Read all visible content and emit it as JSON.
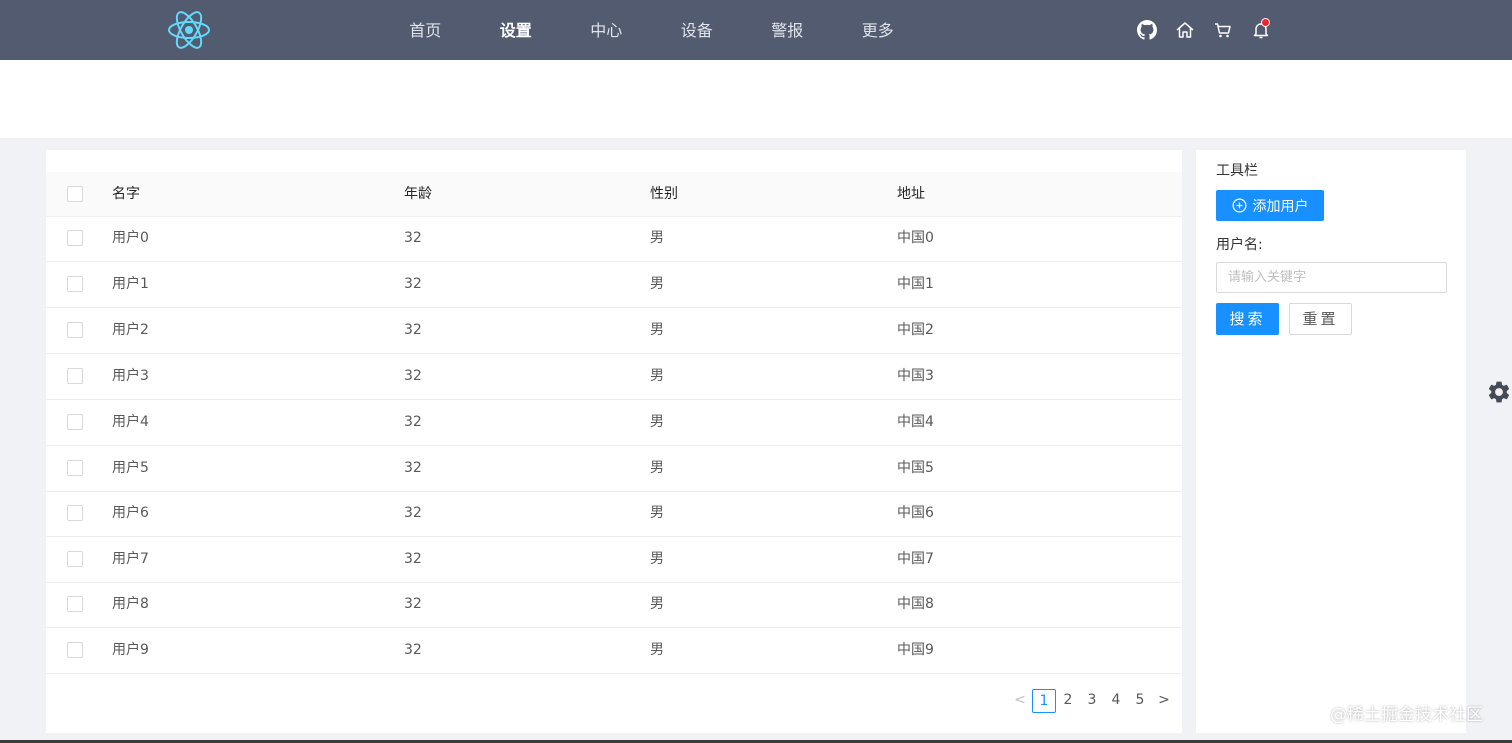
{
  "nav": {
    "items": [
      {
        "label": "首页",
        "active": false
      },
      {
        "label": "设置",
        "active": true
      },
      {
        "label": "中心",
        "active": false
      },
      {
        "label": "设备",
        "active": false
      },
      {
        "label": "警报",
        "active": false
      },
      {
        "label": "更多",
        "active": false
      }
    ],
    "actions": [
      "github-icon",
      "home-icon",
      "cart-icon",
      "bell-icon"
    ]
  },
  "table": {
    "columns": [
      "名字",
      "年龄",
      "性别",
      "地址"
    ],
    "rows": [
      {
        "name": "用户0",
        "age": "32",
        "gender": "男",
        "address": "中国0"
      },
      {
        "name": "用户1",
        "age": "32",
        "gender": "男",
        "address": "中国1"
      },
      {
        "name": "用户2",
        "age": "32",
        "gender": "男",
        "address": "中国2"
      },
      {
        "name": "用户3",
        "age": "32",
        "gender": "男",
        "address": "中国3"
      },
      {
        "name": "用户4",
        "age": "32",
        "gender": "男",
        "address": "中国4"
      },
      {
        "name": "用户5",
        "age": "32",
        "gender": "男",
        "address": "中国5"
      },
      {
        "name": "用户6",
        "age": "32",
        "gender": "男",
        "address": "中国6"
      },
      {
        "name": "用户7",
        "age": "32",
        "gender": "男",
        "address": "中国7"
      },
      {
        "name": "用户8",
        "age": "32",
        "gender": "男",
        "address": "中国8"
      },
      {
        "name": "用户9",
        "age": "32",
        "gender": "男",
        "address": "中国9"
      }
    ]
  },
  "pagination": {
    "pages": [
      "1",
      "2",
      "3",
      "4",
      "5"
    ],
    "current": "1",
    "prev_glyph": "<",
    "next_glyph": ">"
  },
  "toolbar": {
    "title": "工具栏",
    "add_user_label": "添加用户",
    "username_label": "用户名:",
    "search_placeholder": "请输入关键字",
    "search_value": "",
    "search_label": "搜索",
    "reset_label": "重置"
  },
  "watermark": "@稀土掘金技术社区",
  "colors": {
    "header_bg": "#525b6f",
    "primary": "#1890ff",
    "page_bg": "#f0f2f5",
    "notification_dot": "#f5222d",
    "logo": "#61dafb"
  }
}
